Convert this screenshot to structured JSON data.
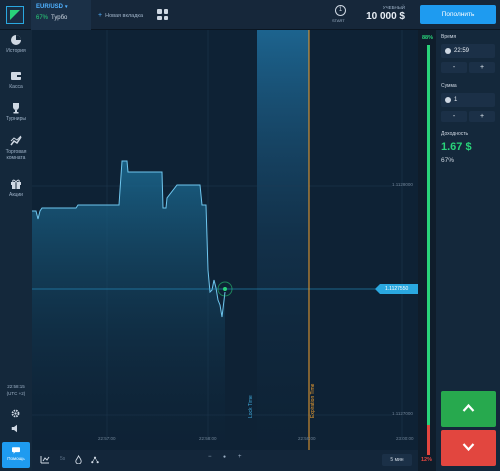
{
  "header": {
    "asset": "EUR/USD",
    "asset_chevron": "▾",
    "asset_payout": "67%",
    "asset_mode": "Турбо",
    "new_tab_label": "Новая вкладка",
    "start_label": "START",
    "start_count": "1",
    "account_label": "УЧЕБНЫЙ",
    "balance": "10 000 $",
    "deposit_label": "Пополнить"
  },
  "sidebar": {
    "items": [
      {
        "label": "История",
        "icon": "history-pie-icon"
      },
      {
        "label": "Касса",
        "icon": "wallet-icon"
      },
      {
        "label": "Турниры",
        "icon": "trophy-icon"
      },
      {
        "label": "Торговая комната",
        "icon": "trading-room-icon"
      },
      {
        "label": "Акции",
        "icon": "gift-icon"
      }
    ],
    "time": "22:58:15",
    "timezone": "(UTC +2)",
    "help_label": "Помощь"
  },
  "chart": {
    "current_price": "1.1127550",
    "price_ticks": [
      "1.1128000",
      "1.1127000"
    ],
    "time_ticks": [
      "22:57:00",
      "22:58:00",
      "22:59:00",
      "23:00:00"
    ],
    "lock_time_label": "Lock Time",
    "expiration_label": "Expiration Time",
    "colors": {
      "line": "#6fc6ee",
      "expiration": "#f0a030",
      "accent": "#2aa8e0"
    }
  },
  "bottom": {
    "timeframe": "5 мин",
    "zoom_out": "−",
    "zoom_reset": "●",
    "zoom_in": "+"
  },
  "payout_bar": {
    "up_pct": "88%",
    "down_pct": "12%"
  },
  "panel": {
    "time_label": "Время",
    "time_value": "22:59",
    "amount_label": "Сумма",
    "amount_value": "1",
    "minus": "-",
    "plus": "+",
    "payout_label": "Доходность",
    "payout_amount": "1.67 $",
    "payout_pct": "67%"
  }
}
